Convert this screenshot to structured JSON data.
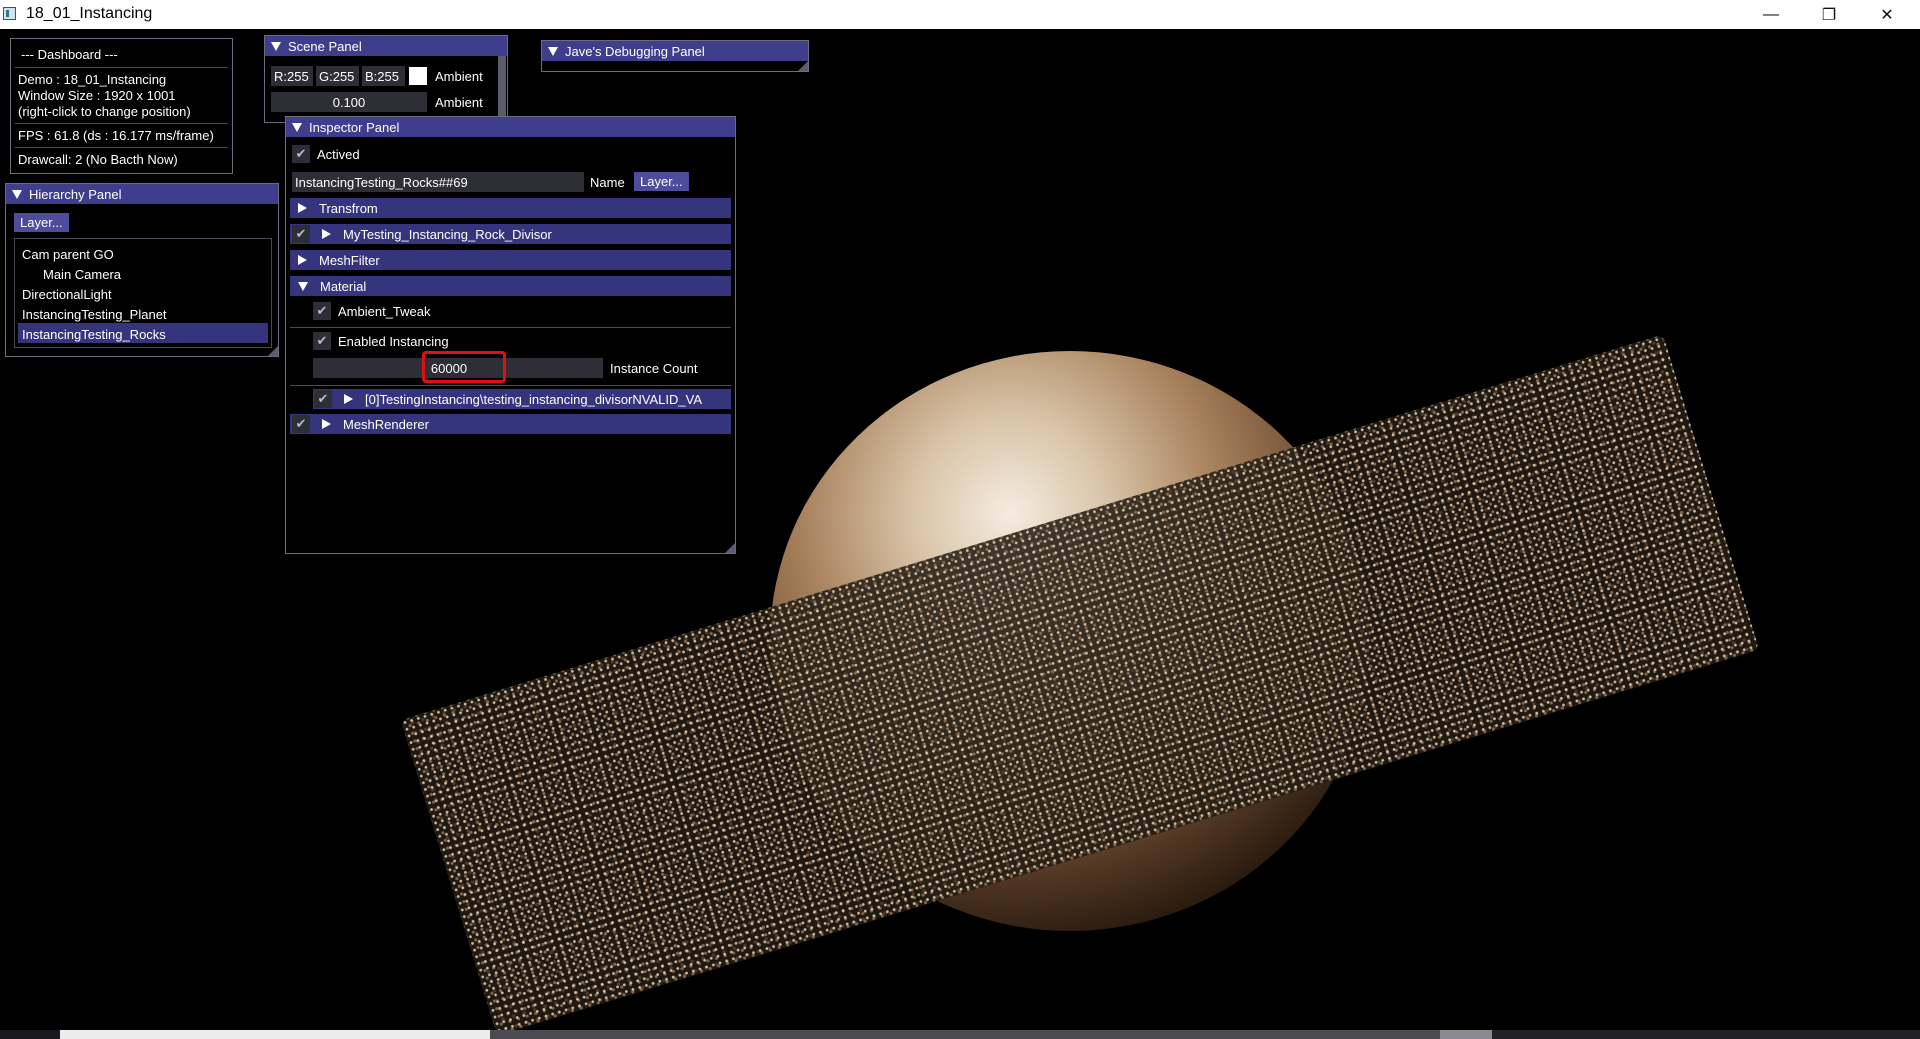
{
  "window": {
    "title": "18_01_Instancing",
    "minimize": "—",
    "maximize": "❐",
    "close": "✕"
  },
  "dashboard": {
    "title": "--- Dashboard ---",
    "demo": "Demo : 18_01_Instancing",
    "size": "Window Size : 1920 x 1001",
    "hint": "(right-click to change position)",
    "fps": "FPS : 61.8 (ds : 16.177 ms/frame)",
    "drawcall": "Drawcall: 2 (No Bacth Now)"
  },
  "scene_panel": {
    "title": "Scene Panel",
    "r": "R:255",
    "g": "G:255",
    "b": "B:255",
    "ambient_label": "Ambient",
    "ambient_value": "0.100",
    "ambient_label2": "Ambient",
    "swatch_color": "#ffffff"
  },
  "debug_panel": {
    "title": "Jave's Debugging Panel"
  },
  "hierarchy": {
    "title": "Hierarchy Panel",
    "layer_button": "Layer...",
    "items": [
      "Cam parent GO",
      "Main Camera",
      "DirectionalLight",
      "InstancingTesting_Planet",
      "InstancingTesting_Rocks"
    ],
    "selected": "InstancingTesting_Rocks"
  },
  "inspector": {
    "title": "Inspector Panel",
    "actived": "Actived",
    "name_value": "InstancingTesting_Rocks##69",
    "name_label": "Name",
    "layer_button": "Layer...",
    "transform": "Transfrom",
    "rock_divisor": "MyTesting_Instancing_Rock_Divisor",
    "meshfilter": "MeshFilter",
    "material": "Material",
    "ambient_tweak": "Ambient_Tweak",
    "enabled_instancing": "Enabled Instancing",
    "instance_count": "60000",
    "instance_count_label": "Instance Count",
    "shader_entry": "[0]TestingInstancing\\testing_instancing_divisorNVALID_VA",
    "meshrenderer": "MeshRenderer",
    "check": "✔"
  },
  "colors": {
    "header": "#3e3e8c",
    "collapsing_header": "#35357e",
    "button": "#4d4d9c",
    "field": "#2e2e36",
    "highlight_box": "#e01010"
  }
}
